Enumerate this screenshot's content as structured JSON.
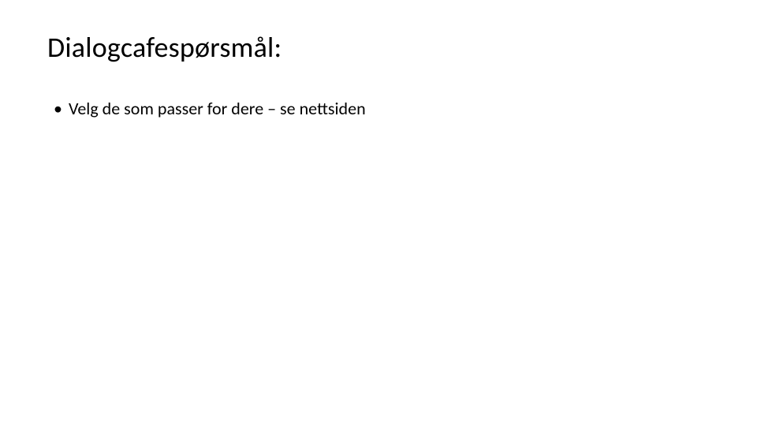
{
  "slide": {
    "title": "Dialogcafespørsmål:",
    "bullets": [
      {
        "marker": "•",
        "text": "Velg de som passer for dere – se nettsiden"
      }
    ]
  }
}
